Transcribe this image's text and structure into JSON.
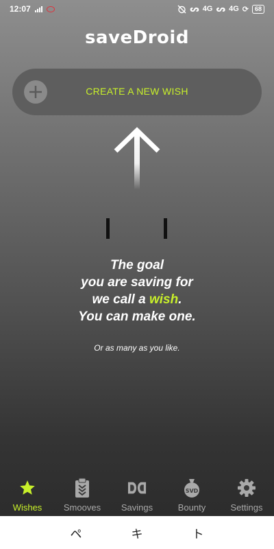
{
  "status_bar": {
    "time": "12:07",
    "network_1": "4G",
    "network_2": "4G",
    "battery": "68"
  },
  "app": {
    "logo": "saveDroid"
  },
  "create_wish": {
    "label": "CREATE A NEW WISH",
    "icon": "plus-icon"
  },
  "message": {
    "line1": "The goal",
    "line2": "you are saving for",
    "line3_prefix": "we call a ",
    "line3_highlight": "wish",
    "line3_suffix": ".",
    "line4": "You can make one.",
    "sub": "Or as many as you like."
  },
  "nav": {
    "items": [
      {
        "label": "Wishes",
        "icon": "star-icon",
        "active": true
      },
      {
        "label": "Smooves",
        "icon": "clipboard-icon",
        "active": false
      },
      {
        "label": "Savings",
        "icon": "dd-icon",
        "active": false
      },
      {
        "label": "Bounty",
        "icon": "money-bag-icon",
        "active": false
      },
      {
        "label": "Settings",
        "icon": "gear-icon",
        "active": false
      }
    ]
  },
  "keyboard": {
    "keys": [
      "ペ",
      "キ",
      "ト"
    ]
  },
  "colors": {
    "accent": "#c8f02a",
    "nav_inactive": "#a9a9a9"
  }
}
